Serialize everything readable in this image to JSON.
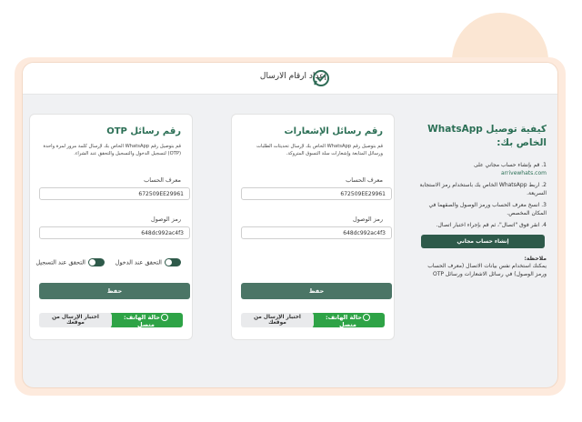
{
  "header": {
    "title": "إعداد ارقام الارسال"
  },
  "info": {
    "title": "كيفية توصيل WhatsApp الخاص بك:",
    "steps": [
      "1. قم بإنشاء حساب مجاني على",
      "2. اربط WhatsApp الخاص بك باستخدام رمز الاستجابة السريعة.",
      "3. انسخ معرف الحساب ورمز الوصول والصقهما في المكان المخصص.",
      "4. انقر فوق \"اتصال\"، ثم قم بإجراء اختبار اتصال."
    ],
    "link": "arrivewhats.com",
    "button_label": "إنشاء حساب مجاني",
    "note_title": "ملاحظة:",
    "note_text": "يمكنك استخدام نفس بيانات الاتصال (معرف الحساب ورمز الوصول) في رسائل الاشعارات ورسائل OTP"
  },
  "notifications_card": {
    "title": "رقم رسائل الإشعارات",
    "description": "قم بتوصيل رقم WhatsApp الخاص بك لإرسال تحديثات الطلبات ورسائل المتابعة وإشعارات سلة التسوق المتروكة.",
    "account_id_label": "معرف الحساب",
    "account_id_value": "672509EE29961",
    "access_token_label": "رمز الوصول",
    "access_token_value": "648dc992ac4f3",
    "save_label": "حفظ",
    "status_label": "حالة الهاتف: متصل",
    "test_label": "اختبار الإرسال من موقعك"
  },
  "otp_card": {
    "title": "رقم رسائل OTP",
    "description": "قم بتوصيل رقم WhatsApp الخاص بك لإرسال كلمة مرور لمرة واحدة (OTP) لتسجيل الدخول والتسجيل والتحقق عند الشراء.",
    "account_id_label": "معرف الحساب",
    "account_id_value": "672509EE29961",
    "access_token_label": "رمز الوصول",
    "access_token_value": "648dc992ac4f3",
    "login_verify_label": "التحقق عند الدخول",
    "register_verify_label": "التحقق عند التسجيل",
    "save_label": "حفظ",
    "status_label": "حالة الهاتف: متصل",
    "test_label": "اختبار الإرسال من موقعك"
  }
}
